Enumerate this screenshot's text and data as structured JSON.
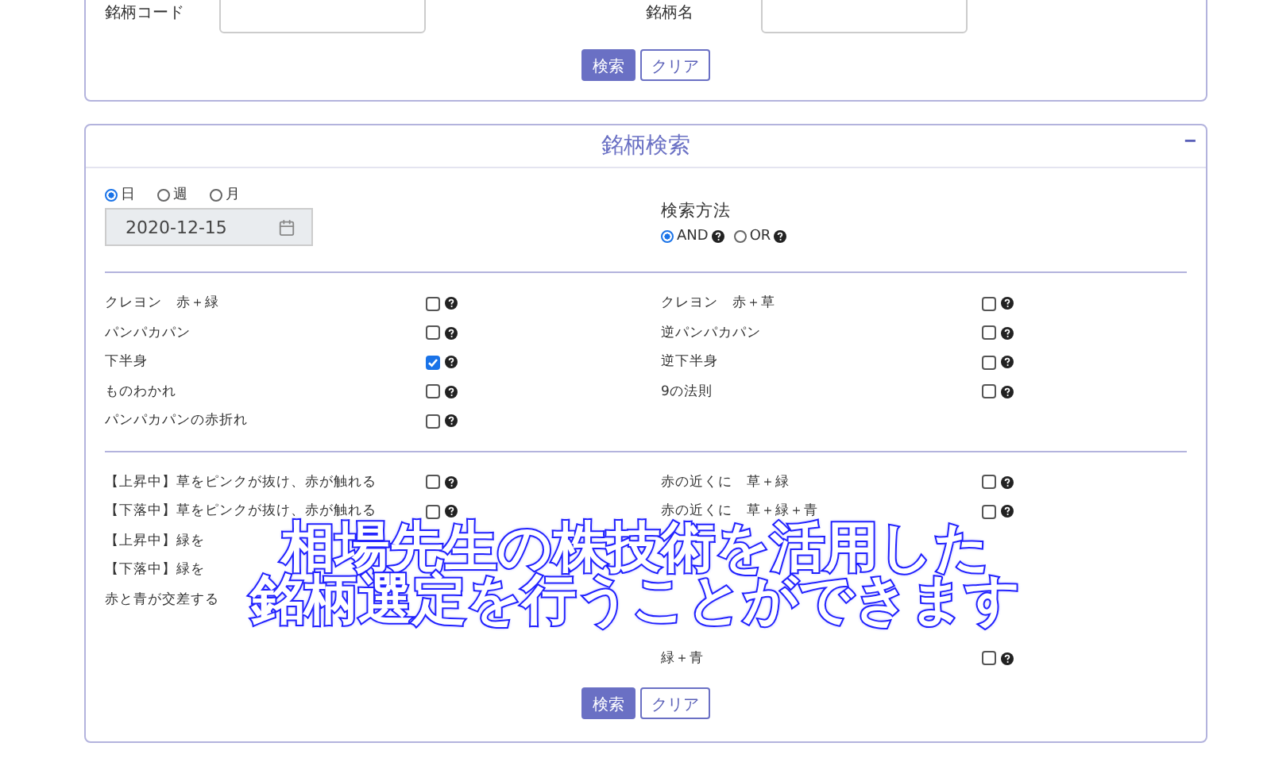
{
  "search_panel": {
    "fields": [
      {
        "label": "銘柄コード"
      },
      {
        "label": "銘柄名"
      }
    ],
    "buttons": [
      {
        "label": "検索",
        "kind": "primary"
      },
      {
        "label": "クリア",
        "kind": "secondary"
      }
    ]
  },
  "stock_search": {
    "title": "銘柄検索",
    "collapse_label": "−",
    "periods": [
      {
        "label": "日",
        "selected": true
      },
      {
        "label": "週",
        "selected": false
      },
      {
        "label": "月",
        "selected": false
      }
    ],
    "date": "2020-12-15",
    "method_title": "検索方法",
    "methods": [
      {
        "label": "AND",
        "selected": true
      },
      {
        "label": "OR",
        "selected": false
      }
    ],
    "groups": [
      {
        "rows": [
          {
            "left": {
              "label": "クレヨン　赤＋緑",
              "checked": false
            },
            "right": {
              "label": "クレヨン　赤＋草",
              "checked": false
            }
          },
          {
            "left": {
              "label": "パンパカパン",
              "checked": false
            },
            "right": {
              "label": "逆パンパカパン",
              "checked": false
            }
          },
          {
            "left": {
              "label": "下半身",
              "checked": true
            },
            "right": {
              "label": "逆下半身",
              "checked": false
            }
          },
          {
            "left": {
              "label": "ものわかれ",
              "checked": false
            },
            "right": {
              "label": "9の法則",
              "checked": false
            }
          },
          {
            "left": {
              "label": "パンパカパンの赤折れ",
              "checked": false
            }
          }
        ]
      },
      {
        "rows": [
          {
            "left": {
              "label": "【上昇中】草をピンクが抜け、赤が触れる",
              "checked": false
            },
            "right": {
              "label": "赤の近くに　草＋緑",
              "checked": false
            }
          },
          {
            "left": {
              "label": "【下落中】草をピンクが抜け、赤が触れる",
              "checked": false
            },
            "right": {
              "label": "赤の近くに　草＋緑＋青",
              "checked": false
            }
          },
          {
            "left": {
              "label": "【上昇中】緑を"
            }
          },
          {
            "left": {
              "label": "【下落中】緑を"
            }
          },
          {
            "left": {
              "label": "赤と青が交差する"
            }
          },
          {},
          {
            "right": {
              "label": "緑＋青",
              "checked": false
            }
          }
        ]
      }
    ],
    "buttons": [
      {
        "label": "検索",
        "kind": "primary"
      },
      {
        "label": "クリア",
        "kind": "secondary"
      }
    ]
  },
  "caption": [
    "相場先生の株技術を活用した",
    "銘柄選定を行うことができます"
  ]
}
